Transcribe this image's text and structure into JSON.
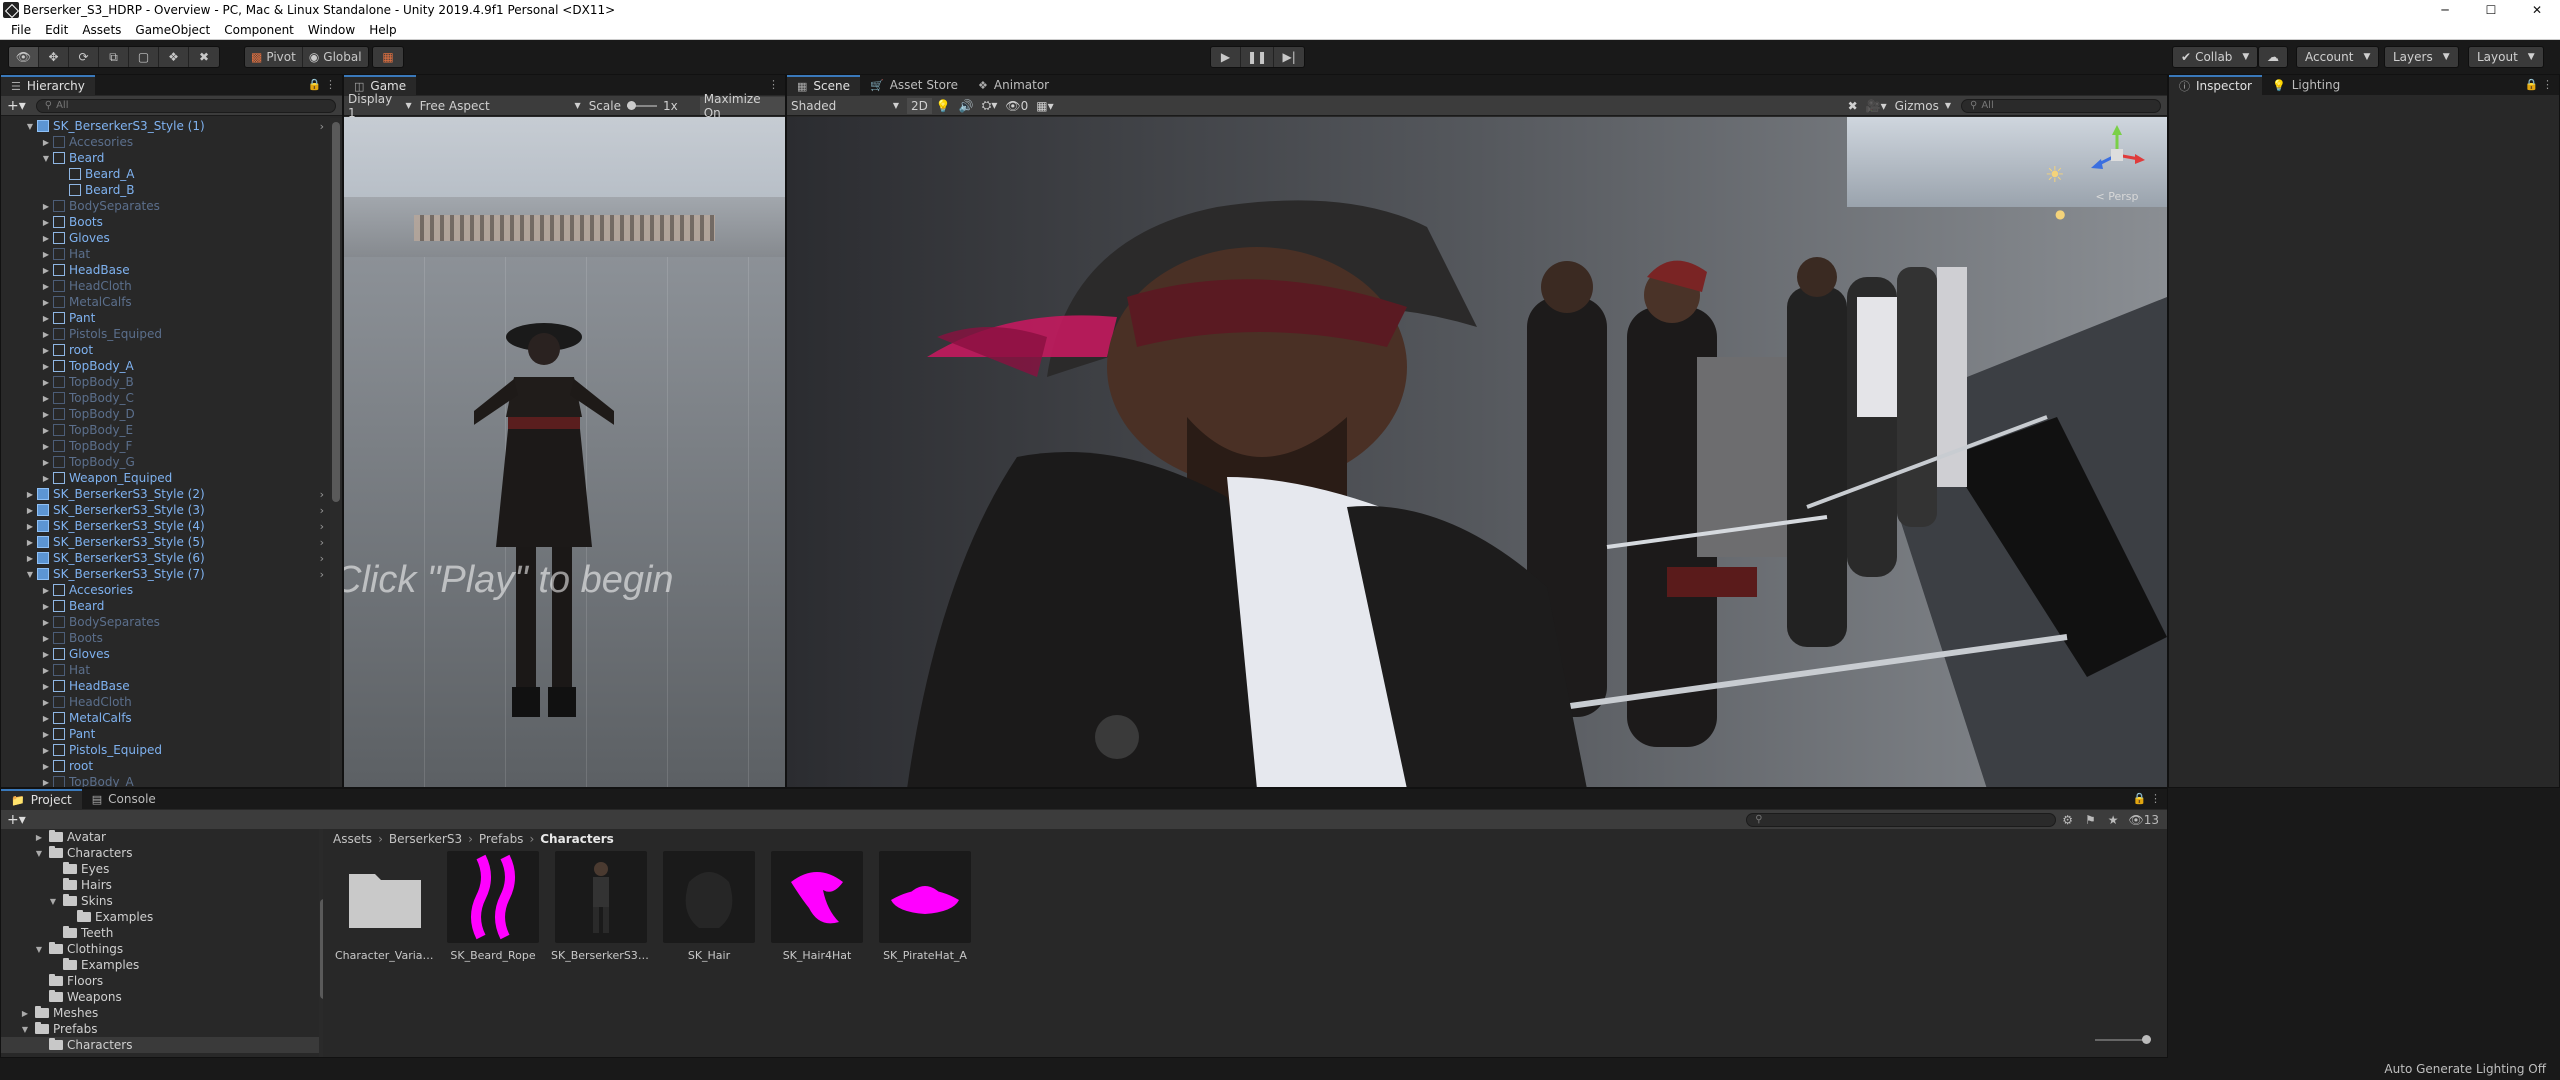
{
  "window": {
    "title": "Berserker_S3_HDRP - Overview - PC, Mac & Linux Standalone - Unity 2019.4.9f1 Personal <DX11>",
    "controls": [
      "─",
      "☐",
      "✕"
    ]
  },
  "menu": [
    "File",
    "Edit",
    "Assets",
    "GameObject",
    "Component",
    "Window",
    "Help"
  ],
  "toolbar": {
    "pivot": "Pivot",
    "global": "Global",
    "collab": "Collab",
    "account": "Account",
    "layers": "Layers",
    "layout": "Layout"
  },
  "hierarchy": {
    "tab": "Hierarchy",
    "search_placeholder": "All",
    "rows": [
      {
        "label": "SK_BerserkerS3_Style (1)",
        "depth": 0,
        "state": "root",
        "expanded": true
      },
      {
        "label": "Accesories",
        "depth": 1,
        "state": "disabled"
      },
      {
        "label": "Beard",
        "depth": 1,
        "state": "normal",
        "expanded": true
      },
      {
        "label": "Beard_A",
        "depth": 2,
        "state": "normal"
      },
      {
        "label": "Beard_B",
        "depth": 2,
        "state": "normal"
      },
      {
        "label": "BodySeparates",
        "depth": 1,
        "state": "disabled"
      },
      {
        "label": "Boots",
        "depth": 1,
        "state": "normal"
      },
      {
        "label": "Gloves",
        "depth": 1,
        "state": "normal"
      },
      {
        "label": "Hat",
        "depth": 1,
        "state": "disabled"
      },
      {
        "label": "HeadBase",
        "depth": 1,
        "state": "normal"
      },
      {
        "label": "HeadCloth",
        "depth": 1,
        "state": "disabled"
      },
      {
        "label": "MetalCalfs",
        "depth": 1,
        "state": "disabled"
      },
      {
        "label": "Pant",
        "depth": 1,
        "state": "normal"
      },
      {
        "label": "Pistols_Equiped",
        "depth": 1,
        "state": "disabled"
      },
      {
        "label": "root",
        "depth": 1,
        "state": "normal"
      },
      {
        "label": "TopBody_A",
        "depth": 1,
        "state": "normal"
      },
      {
        "label": "TopBody_B",
        "depth": 1,
        "state": "disabled"
      },
      {
        "label": "TopBody_C",
        "depth": 1,
        "state": "disabled"
      },
      {
        "label": "TopBody_D",
        "depth": 1,
        "state": "disabled"
      },
      {
        "label": "TopBody_E",
        "depth": 1,
        "state": "disabled"
      },
      {
        "label": "TopBody_F",
        "depth": 1,
        "state": "disabled"
      },
      {
        "label": "TopBody_G",
        "depth": 1,
        "state": "disabled"
      },
      {
        "label": "Weapon_Equiped",
        "depth": 1,
        "state": "normal"
      },
      {
        "label": "SK_BerserkerS3_Style (2)",
        "depth": 0,
        "state": "root"
      },
      {
        "label": "SK_BerserkerS3_Style (3)",
        "depth": 0,
        "state": "root"
      },
      {
        "label": "SK_BerserkerS3_Style (4)",
        "depth": 0,
        "state": "root"
      },
      {
        "label": "SK_BerserkerS3_Style (5)",
        "depth": 0,
        "state": "root"
      },
      {
        "label": "SK_BerserkerS3_Style (6)",
        "depth": 0,
        "state": "root"
      },
      {
        "label": "SK_BerserkerS3_Style (7)",
        "depth": 0,
        "state": "root",
        "expanded": true
      },
      {
        "label": "Accesories",
        "depth": 1,
        "state": "normal"
      },
      {
        "label": "Beard",
        "depth": 1,
        "state": "normal"
      },
      {
        "label": "BodySeparates",
        "depth": 1,
        "state": "disabled"
      },
      {
        "label": "Boots",
        "depth": 1,
        "state": "disabled"
      },
      {
        "label": "Gloves",
        "depth": 1,
        "state": "normal"
      },
      {
        "label": "Hat",
        "depth": 1,
        "state": "disabled"
      },
      {
        "label": "HeadBase",
        "depth": 1,
        "state": "normal"
      },
      {
        "label": "HeadCloth",
        "depth": 1,
        "state": "disabled"
      },
      {
        "label": "MetalCalfs",
        "depth": 1,
        "state": "normal"
      },
      {
        "label": "Pant",
        "depth": 1,
        "state": "normal"
      },
      {
        "label": "Pistols_Equiped",
        "depth": 1,
        "state": "normal"
      },
      {
        "label": "root",
        "depth": 1,
        "state": "normal"
      },
      {
        "label": "TopBody_A",
        "depth": 1,
        "state": "disabled"
      }
    ]
  },
  "game": {
    "tab": "Game",
    "display": "Display 1",
    "aspect": "Free Aspect",
    "scale_label": "Scale",
    "scale_value": "1x",
    "maximize": "Maximize On",
    "hint": "Click \"Play\" to begin"
  },
  "scene": {
    "tabs": [
      "Scene",
      "Asset Store",
      "Animator"
    ],
    "shading": "Shaded",
    "mode_2d": "2D",
    "hidden_count": "0",
    "gizmos": "Gizmos",
    "search_placeholder": "All",
    "persp": "< Persp"
  },
  "inspector": {
    "tabs": [
      "Inspector",
      "Lighting"
    ]
  },
  "project": {
    "tabs": [
      "Project",
      "Console"
    ],
    "hidden_count": "13",
    "tree": [
      {
        "label": "Avatar",
        "depth": 1,
        "expanded": false
      },
      {
        "label": "Characters",
        "depth": 1,
        "expanded": true
      },
      {
        "label": "Eyes",
        "depth": 2
      },
      {
        "label": "Hairs",
        "depth": 2
      },
      {
        "label": "Skins",
        "depth": 2,
        "expanded": true
      },
      {
        "label": "Examples",
        "depth": 3
      },
      {
        "label": "Teeth",
        "depth": 2
      },
      {
        "label": "Clothings",
        "depth": 1,
        "expanded": true
      },
      {
        "label": "Examples",
        "depth": 2
      },
      {
        "label": "Floors",
        "depth": 1
      },
      {
        "label": "Weapons",
        "depth": 1
      },
      {
        "label": "Meshes",
        "depth": 0,
        "expanded": false
      },
      {
        "label": "Prefabs",
        "depth": 0,
        "expanded": true
      },
      {
        "label": "Characters",
        "depth": 1,
        "selected": true
      }
    ],
    "breadcrumb": [
      "Assets",
      "BerserkerS3",
      "Prefabs",
      "Characters"
    ],
    "assets": [
      {
        "label": "Character_Varian...",
        "kind": "folder"
      },
      {
        "label": "SK_Beard_Rope",
        "kind": "magenta-rope"
      },
      {
        "label": "SK_BerserkerS3_...",
        "kind": "character"
      },
      {
        "label": "SK_Hair",
        "kind": "dark-hair"
      },
      {
        "label": "SK_Hair4Hat",
        "kind": "magenta-hair"
      },
      {
        "label": "SK_PirateHat_A",
        "kind": "magenta-hat"
      }
    ]
  },
  "status": {
    "text": "Auto Generate Lighting Off"
  },
  "colors": {
    "accent": "#3a79bb",
    "prefab_text": "#7fb2f0",
    "disabled_prefab_text": "#5b6f8c",
    "missing_texture": "#ff00ff"
  }
}
